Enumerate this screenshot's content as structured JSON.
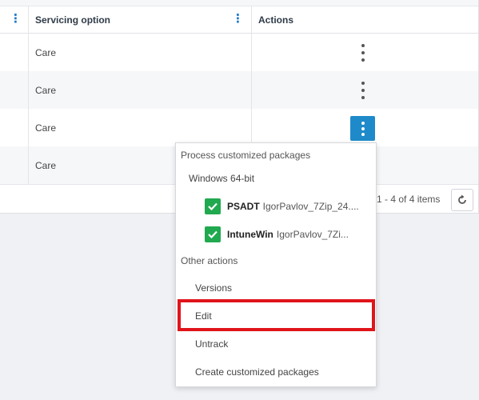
{
  "table": {
    "columns": {
      "servicing": "Servicing option",
      "actions": "Actions"
    },
    "rows": [
      {
        "servicing": "Care"
      },
      {
        "servicing": "Care"
      },
      {
        "servicing": "Care"
      },
      {
        "servicing": "Care"
      }
    ],
    "pager": "1 - 4 of 4 items"
  },
  "menu": {
    "section_custom": "Process customized packages",
    "platform": "Windows 64-bit",
    "packages": [
      {
        "type": "PSADT",
        "name": "IgorPavlov_7Zip_24...."
      },
      {
        "type": "IntuneWin",
        "name": "IgorPavlov_7Zi..."
      }
    ],
    "section_other": "Other actions",
    "items": [
      "Versions",
      "Edit",
      "Untrack",
      "Create customized packages"
    ]
  },
  "colors": {
    "accent": "#1f8ac9",
    "check": "#21a94f",
    "highlight": "#e0141b"
  },
  "icons": [
    "kebab-icon",
    "refresh-icon",
    "check-icon"
  ]
}
